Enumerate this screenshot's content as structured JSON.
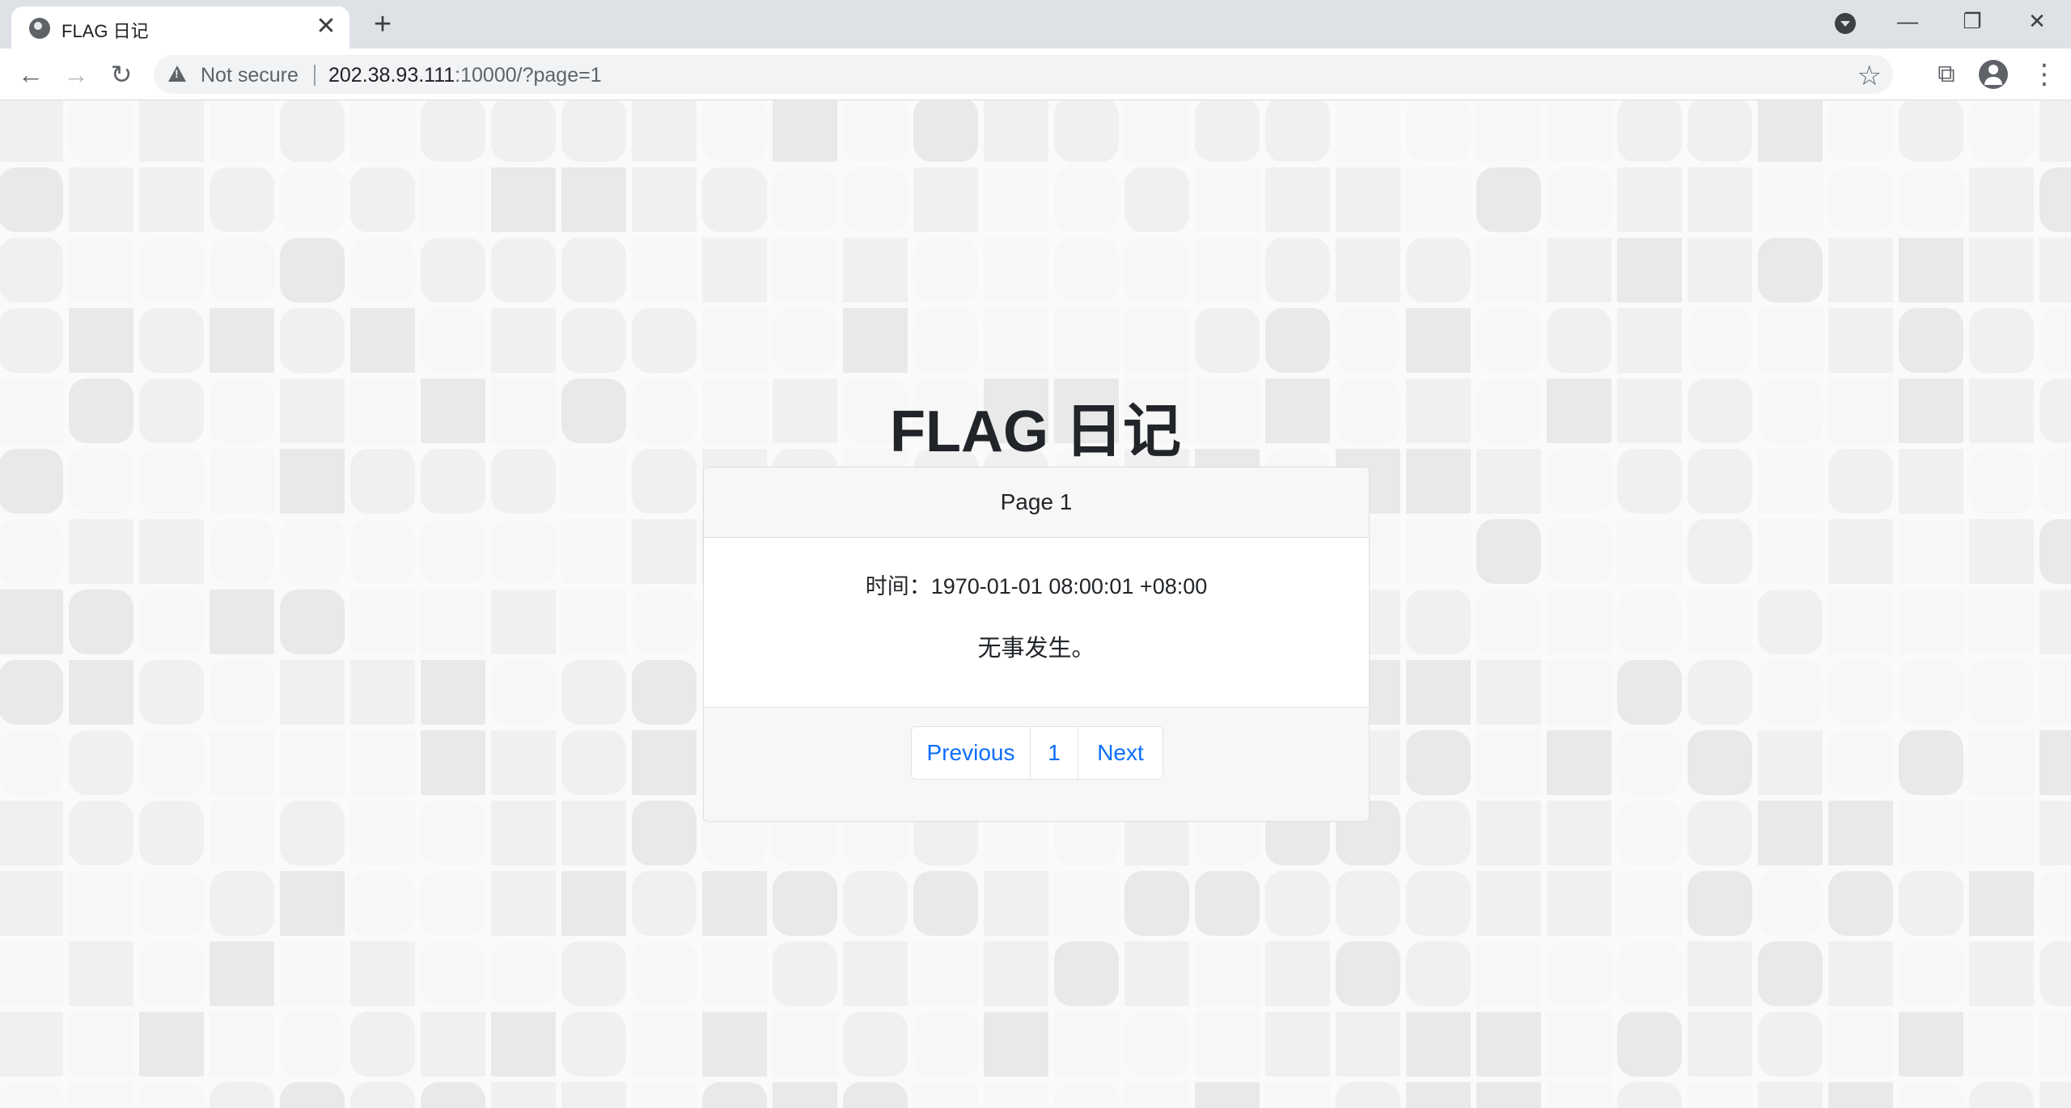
{
  "browser": {
    "tab_title": "FLAG 日记",
    "tab_close": "✕",
    "new_tab": "+",
    "security_label": "Not secure",
    "url_host": "202.38.93.111",
    "url_rest": ":10000/?page=1",
    "window_minimize": "—",
    "window_restore": "❐",
    "window_close": "✕"
  },
  "page": {
    "title": "FLAG 日记",
    "card_header": "Page 1",
    "entry_time": "时间：1970-01-01 08:00:01 +08:00",
    "entry_text": "无事发生。"
  },
  "pagination": {
    "previous": "Previous",
    "current": "1",
    "next": "Next"
  },
  "colors": {
    "link": "#0d6efd",
    "chrome": "#dee1e6",
    "tile_shades": [
      "#f7f7f7",
      "#f0f0f0",
      "#e9e9e9"
    ]
  },
  "icons": {
    "favicon": "globe-icon",
    "back": "arrow-left-icon",
    "forward": "arrow-right-icon",
    "reload": "reload-icon",
    "security": "warning-icon",
    "bookmark": "star-icon",
    "extensions": "puzzle-icon",
    "profile": "avatar-icon",
    "menu": "kebab-menu-icon",
    "tab_search": "tab-search-icon"
  }
}
